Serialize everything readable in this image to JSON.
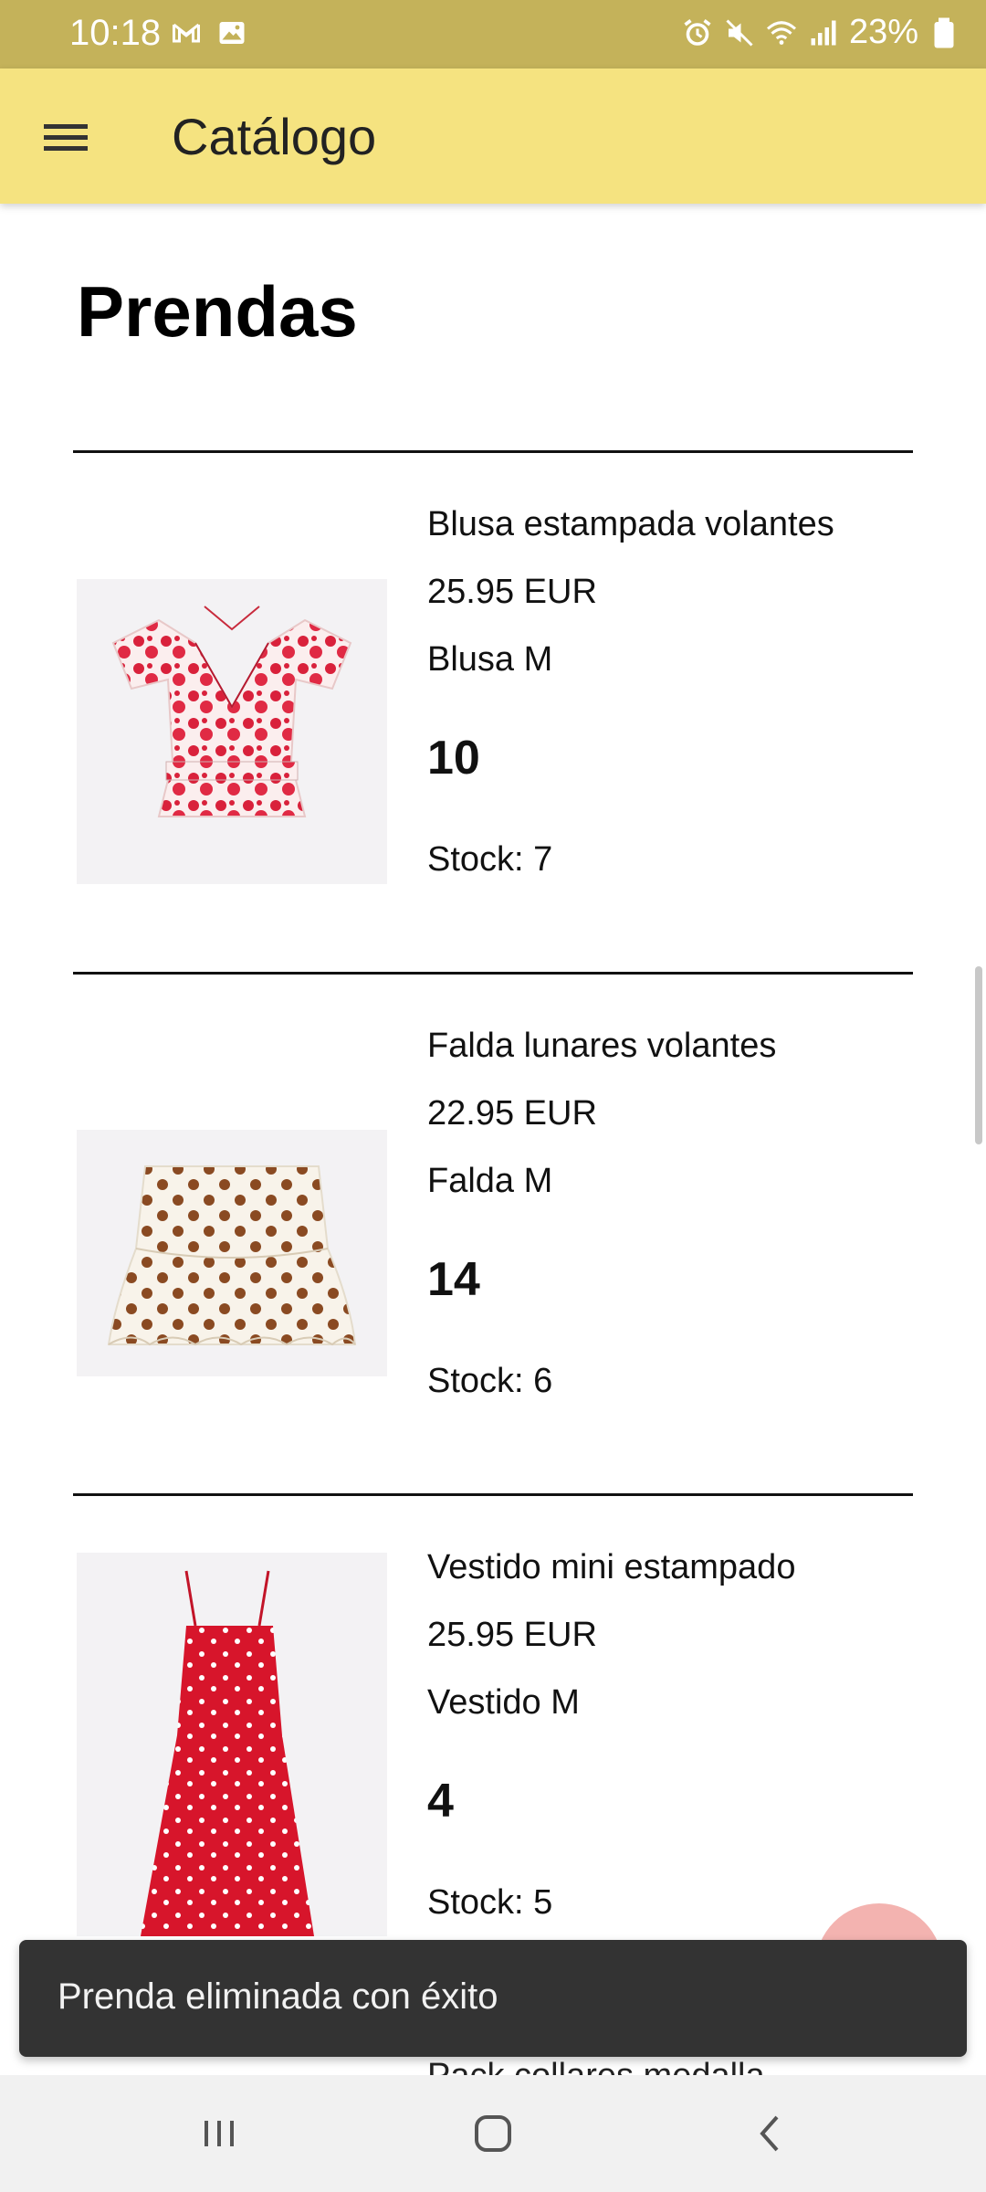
{
  "status_bar": {
    "time": "10:18",
    "battery": "23%",
    "left_icons": [
      "gmail-icon",
      "image-icon"
    ],
    "right_icons": [
      "alarm-icon",
      "mute-icon",
      "wifi-icon",
      "signal-icon",
      "battery-icon"
    ]
  },
  "app_bar": {
    "title": "Catálogo",
    "menu_icon": "hamburger-menu-icon"
  },
  "page": {
    "title": "Prendas"
  },
  "items": [
    {
      "name": "Blusa estampada volantes",
      "price": "25.95 EUR",
      "type": "Blusa M",
      "quantity": "10",
      "stock": "Stock: 7"
    },
    {
      "name": "Falda lunares volantes",
      "price": "22.95 EUR",
      "type": "Falda M",
      "quantity": "14",
      "stock": "Stock: 6"
    },
    {
      "name": "Vestido mini estampado",
      "price": "25.95 EUR",
      "type": "Vestido M",
      "quantity": "4",
      "stock": "Stock: 5"
    }
  ],
  "partial_next_item": "Pack collares medalla",
  "snackbar": {
    "message": "Prenda eliminada con éxito"
  },
  "nav_bar": {
    "buttons": [
      "recents-icon",
      "home-icon",
      "back-icon"
    ]
  },
  "colors": {
    "status_bar": "#c4b25a",
    "app_bar": "#f5e380",
    "snackbar": "#333333",
    "fab": "#f3b3b0"
  }
}
